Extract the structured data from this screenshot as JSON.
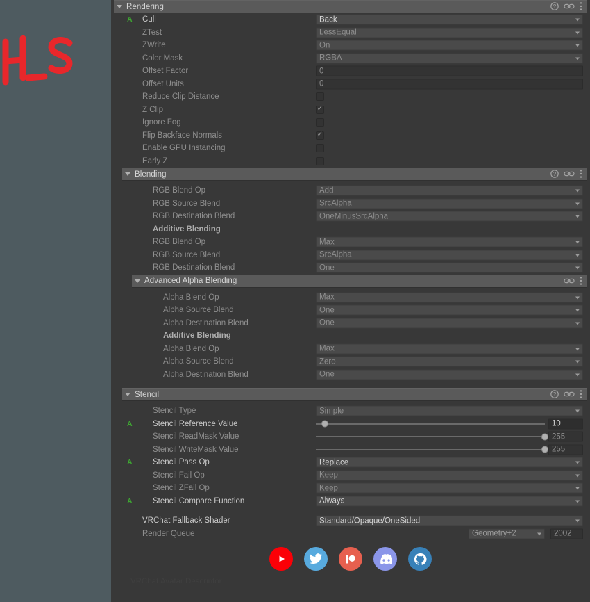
{
  "scratch": {
    "annotation": "H_S",
    "ink_color": "#e8272b",
    "background": "#4e5b60"
  },
  "inspector": {
    "background": "#383838",
    "header_icons": [
      "help-icon",
      "link-icon",
      "menu-icon"
    ]
  },
  "sections": [
    {
      "id": "rendering",
      "title": "Rendering",
      "level": 0,
      "expanded": true,
      "icons": [
        "help-icon",
        "link-icon",
        "menu-icon"
      ],
      "rows": [
        {
          "kind": "dropdown",
          "label": "Cull",
          "value": "Back",
          "animated": true,
          "enabled": true,
          "indent": 1
        },
        {
          "kind": "dropdown",
          "label": "ZTest",
          "value": "LessEqual",
          "animated": false,
          "enabled": false,
          "indent": 1
        },
        {
          "kind": "dropdown",
          "label": "ZWrite",
          "value": "On",
          "animated": false,
          "enabled": false,
          "indent": 1
        },
        {
          "kind": "dropdown",
          "label": "Color Mask",
          "value": "RGBA",
          "animated": false,
          "enabled": false,
          "indent": 1
        },
        {
          "kind": "number",
          "label": "Offset Factor",
          "value": "0",
          "animated": false,
          "enabled": false,
          "indent": 1
        },
        {
          "kind": "number",
          "label": "Offset Units",
          "value": "0",
          "animated": false,
          "enabled": false,
          "indent": 1
        },
        {
          "kind": "checkbox",
          "label": "Reduce Clip Distance",
          "checked": false,
          "animated": false,
          "enabled": false,
          "indent": 1
        },
        {
          "kind": "checkbox",
          "label": "Z Clip",
          "checked": true,
          "animated": false,
          "enabled": false,
          "indent": 1
        },
        {
          "kind": "checkbox",
          "label": "Ignore Fog",
          "checked": false,
          "animated": false,
          "enabled": false,
          "indent": 1
        },
        {
          "kind": "checkbox",
          "label": "Flip Backface Normals",
          "checked": true,
          "animated": false,
          "enabled": false,
          "indent": 1
        },
        {
          "kind": "checkbox",
          "label": "Enable GPU Instancing",
          "checked": false,
          "animated": false,
          "enabled": false,
          "indent": 1
        },
        {
          "kind": "checkbox",
          "label": "Early Z",
          "checked": false,
          "animated": false,
          "enabled": false,
          "indent": 1
        }
      ]
    },
    {
      "id": "blending",
      "title": "Blending",
      "level": 1,
      "expanded": true,
      "icons": [
        "help-icon",
        "link-icon",
        "menu-icon"
      ],
      "rows": [
        {
          "kind": "spacer-sm"
        },
        {
          "kind": "dropdown",
          "label": "RGB Blend Op",
          "value": "Add",
          "animated": false,
          "enabled": false,
          "indent": 2
        },
        {
          "kind": "dropdown",
          "label": "RGB Source Blend",
          "value": "SrcAlpha",
          "animated": false,
          "enabled": false,
          "indent": 2
        },
        {
          "kind": "dropdown",
          "label": "RGB Destination Blend",
          "value": "OneMinusSrcAlpha",
          "animated": false,
          "enabled": false,
          "indent": 2
        },
        {
          "kind": "subheader",
          "label": "Additive Blending",
          "indent": 2
        },
        {
          "kind": "dropdown",
          "label": "RGB Blend Op",
          "value": "Max",
          "animated": false,
          "enabled": false,
          "indent": 2
        },
        {
          "kind": "dropdown",
          "label": "RGB Source Blend",
          "value": "SrcAlpha",
          "animated": false,
          "enabled": false,
          "indent": 2
        },
        {
          "kind": "dropdown",
          "label": "RGB Destination Blend",
          "value": "One",
          "animated": false,
          "enabled": false,
          "indent": 2
        }
      ]
    },
    {
      "id": "advanced-alpha-blending",
      "title": "Advanced Alpha Blending",
      "level": 2,
      "expanded": true,
      "icons": [
        "link-icon",
        "menu-icon"
      ],
      "rows": [
        {
          "kind": "spacer-sm"
        },
        {
          "kind": "dropdown",
          "label": "Alpha Blend Op",
          "value": "Max",
          "animated": false,
          "enabled": false,
          "indent": 3
        },
        {
          "kind": "dropdown",
          "label": "Alpha Source Blend",
          "value": "One",
          "animated": false,
          "enabled": false,
          "indent": 3
        },
        {
          "kind": "dropdown",
          "label": "Alpha Destination Blend",
          "value": "One",
          "animated": false,
          "enabled": false,
          "indent": 3
        },
        {
          "kind": "subheader",
          "label": "Additive Blending",
          "indent": 3
        },
        {
          "kind": "dropdown",
          "label": "Alpha Blend Op",
          "value": "Max",
          "animated": false,
          "enabled": false,
          "indent": 3
        },
        {
          "kind": "dropdown",
          "label": "Alpha Source Blend",
          "value": "Zero",
          "animated": false,
          "enabled": false,
          "indent": 3
        },
        {
          "kind": "dropdown",
          "label": "Alpha Destination Blend",
          "value": "One",
          "animated": false,
          "enabled": false,
          "indent": 3
        },
        {
          "kind": "spacer"
        }
      ]
    },
    {
      "id": "stencil",
      "title": "Stencil",
      "level": 1,
      "expanded": true,
      "icons": [
        "help-icon",
        "link-icon",
        "menu-icon"
      ],
      "rows": [
        {
          "kind": "spacer-sm"
        },
        {
          "kind": "dropdown",
          "label": "Stencil Type",
          "value": "Simple",
          "animated": false,
          "enabled": false,
          "indent": 2
        },
        {
          "kind": "slider",
          "label": "Stencil Reference Value",
          "value": "10",
          "percent": 4,
          "animated": true,
          "enabled": true,
          "indent": 2
        },
        {
          "kind": "slider",
          "label": "Stencil ReadMask Value",
          "value": "255",
          "percent": 100,
          "animated": false,
          "enabled": false,
          "indent": 2
        },
        {
          "kind": "slider",
          "label": "Stencil WriteMask Value",
          "value": "255",
          "percent": 100,
          "animated": false,
          "enabled": false,
          "indent": 2
        },
        {
          "kind": "dropdown",
          "label": "Stencil Pass Op",
          "value": "Replace",
          "animated": true,
          "enabled": true,
          "indent": 2
        },
        {
          "kind": "dropdown",
          "label": "Stencil Fail Op",
          "value": "Keep",
          "animated": false,
          "enabled": false,
          "indent": 2
        },
        {
          "kind": "dropdown",
          "label": "Stencil ZFail Op",
          "value": "Keep",
          "animated": false,
          "enabled": false,
          "indent": 2
        },
        {
          "kind": "dropdown",
          "label": "Stencil Compare Function",
          "value": "Always",
          "animated": true,
          "enabled": true,
          "indent": 2
        },
        {
          "kind": "spacer"
        },
        {
          "kind": "dropdown",
          "label": "VRChat Fallback Shader",
          "value": "Standard/Opaque/OneSided",
          "animated": false,
          "enabled": true,
          "indent": 1
        },
        {
          "kind": "renderqueue",
          "label": "Render Queue",
          "preset": "Geometry+2",
          "value": "2002",
          "indent": 1
        }
      ]
    }
  ],
  "social": [
    {
      "name": "youtube",
      "label": "YouTube",
      "color": "#fb0007"
    },
    {
      "name": "twitter",
      "label": "Twitter",
      "color": "#58aade"
    },
    {
      "name": "patreon",
      "label": "Patreon",
      "color": "#e7604f"
    },
    {
      "name": "discord",
      "label": "Discord",
      "color": "#8b96e9"
    },
    {
      "name": "github",
      "label": "GitHub",
      "color": "#3881b8"
    }
  ],
  "bottom_cut_label": "VRChat Avatar Descriptor"
}
